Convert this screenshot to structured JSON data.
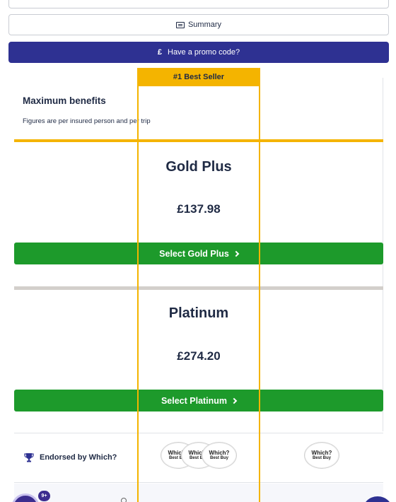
{
  "header": {
    "summary_label": "Summary",
    "promo_symbol": "£",
    "promo_label": "Have a promo code?"
  },
  "table": {
    "best_seller_label": "#1 Best Seller",
    "benefits_title": "Maximum benefits",
    "benefits_note": "Figures are per insured person and per trip",
    "plans": [
      {
        "name": "Gold Plus",
        "price": "£137.98",
        "select_label": "Select Gold Plus"
      },
      {
        "name": "Platinum",
        "price": "£274.20",
        "select_label": "Select Platinum"
      }
    ],
    "endorsed_label": "Endorsed by Which?",
    "badge_line1": "Which?",
    "badge_line2": "Best Buy"
  },
  "widgets": {
    "notification_count": "9+"
  },
  "colors": {
    "accent_gold": "#f4b400",
    "promo_blue": "#2e3192",
    "select_green": "#1d9a2b",
    "text_navy": "#1f2a44"
  }
}
